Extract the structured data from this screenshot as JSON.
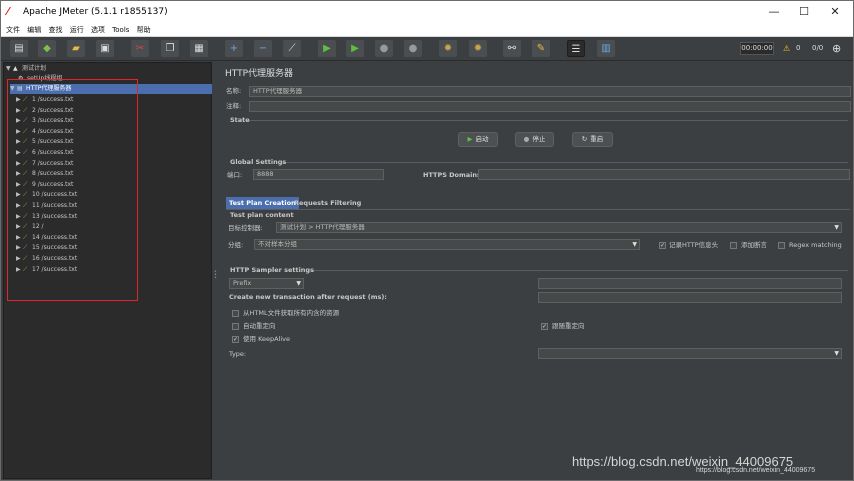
{
  "window": {
    "title": "Apache JMeter (5.1.1 r1855137)",
    "controls": {
      "minimize": "—",
      "maximize": "☐",
      "close": "✕"
    }
  },
  "menu": [
    "文件",
    "编辑",
    "查找",
    "运行",
    "选项",
    "Tools",
    "帮助"
  ],
  "toolbar": {
    "timer": "00:00:00",
    "warn_count": "0",
    "thread_ratio": "0/0"
  },
  "tree": {
    "root": "测试计划",
    "items": [
      {
        "label": "setUp线程组",
        "depth": 1,
        "icon": "thread-group-icon",
        "selected": false
      },
      {
        "label": "HTTP代理服务器",
        "depth": 1,
        "icon": "proxy-icon",
        "selected": true
      },
      {
        "label": "1 /success.txt",
        "depth": 1
      },
      {
        "label": "2 /success.txt",
        "depth": 1
      },
      {
        "label": "3 /success.txt",
        "depth": 1
      },
      {
        "label": "4 /success.txt",
        "depth": 1
      },
      {
        "label": "5 /success.txt",
        "depth": 1
      },
      {
        "label": "6 /success.txt",
        "depth": 1
      },
      {
        "label": "7 /success.txt",
        "depth": 1
      },
      {
        "label": "8 /success.txt",
        "depth": 1
      },
      {
        "label": "9 /success.txt",
        "depth": 1
      },
      {
        "label": "10 /success.txt",
        "depth": 1
      },
      {
        "label": "11 /success.txt",
        "depth": 1
      },
      {
        "label": "13 /success.txt",
        "depth": 1
      },
      {
        "label": "12 /",
        "depth": 1
      },
      {
        "label": "14 /success.txt",
        "depth": 1
      },
      {
        "label": "15 /success.txt",
        "depth": 1
      },
      {
        "label": "16 /success.txt",
        "depth": 1
      },
      {
        "label": "17 /success.txt",
        "depth": 1
      }
    ]
  },
  "panel": {
    "title": "HTTP代理服务器",
    "name_label": "名称:",
    "name_value": "HTTP代理服务器",
    "comment_label": "注释:",
    "state_label": "State",
    "start_button": "启动",
    "stop_button": "停止",
    "restart_button": "重启",
    "global_settings": "Global Settings",
    "port_label": "端口:",
    "port_value": "8888",
    "https_domains_label": "HTTPS Domains:",
    "tabs": [
      "Test Plan Creation",
      "Requests Filtering"
    ],
    "test_plan_content": "Test plan content",
    "target_controller_label": "目标控制器:",
    "target_controller_value": "测试计划 > HTTP代理服务器",
    "grouping_label": "分组:",
    "grouping_value": "不对样本分组",
    "record_headers": "记录HTTP信息头",
    "add_assertions": "添加断言",
    "regex_matching": "Regex matching",
    "sampler_settings": "HTTP Sampler settings",
    "prefix_value": "Prefix",
    "create_new_tx": "Create new transaction after request (ms):",
    "retrieve_embedded": "从HTML文件获取所有内含的资源",
    "redirect_auto": "自动重定向",
    "follow_redirects": "跟随重定向",
    "use_keepalive": "使用 KeepAlive",
    "type_label": "Type:"
  },
  "watermark": {
    "main": "https://blog.csdn.net/weixin_44009675",
    "small": "https://blog.csdn.net/weixin_44009675"
  }
}
